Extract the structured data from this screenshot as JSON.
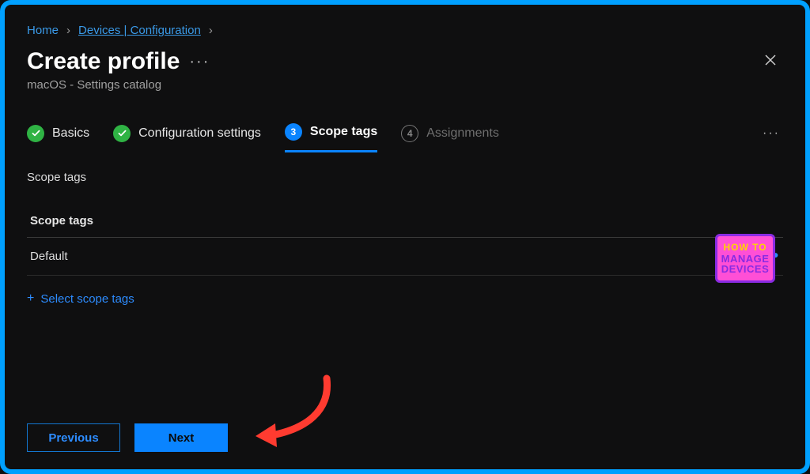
{
  "breadcrumb": {
    "home": "Home",
    "devices": "Devices | Configuration"
  },
  "header": {
    "title": "Create profile",
    "subtitle": "macOS - Settings catalog"
  },
  "steps": {
    "basics": "Basics",
    "config": "Configuration settings",
    "scope": "Scope tags",
    "scope_num": "3",
    "assign": "Assignments",
    "assign_num": "4"
  },
  "section": {
    "label": "Scope tags",
    "table_header": "Scope tags",
    "rows": [
      "Default"
    ],
    "add_link": "Select scope tags"
  },
  "buttons": {
    "previous": "Previous",
    "next": "Next"
  },
  "watermark": {
    "l1": "HOW TO",
    "l2": "MANAGE",
    "l3": "DEVICES"
  }
}
